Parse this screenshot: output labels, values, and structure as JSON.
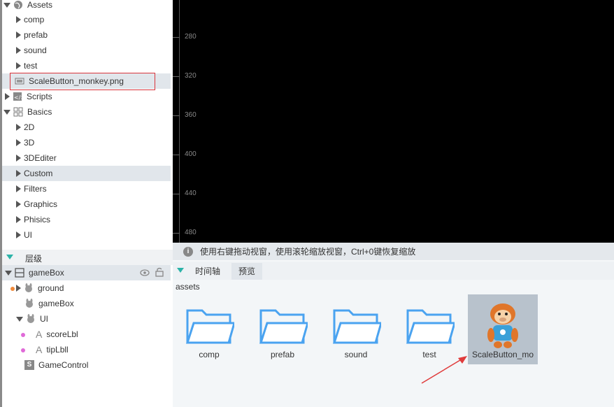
{
  "project_tree": {
    "items": [
      {
        "label": "Assets",
        "depth": 0,
        "icon": "globe-icon"
      },
      {
        "label": "comp",
        "depth": 1
      },
      {
        "label": "prefab",
        "depth": 1
      },
      {
        "label": "sound",
        "depth": 1
      },
      {
        "label": "test",
        "depth": 1
      },
      {
        "label": "ScaleButton_monkey.png",
        "depth": 1,
        "icon": "image-file-icon"
      },
      {
        "label": "Scripts",
        "depth": 0,
        "icon": "script-icon"
      },
      {
        "label": "Basics",
        "depth": 0,
        "icon": "grid-icon"
      },
      {
        "label": "2D",
        "depth": 1
      },
      {
        "label": "3D",
        "depth": 1
      },
      {
        "label": "3DEditer",
        "depth": 1
      },
      {
        "label": "Custom",
        "depth": 1
      },
      {
        "label": "Filters",
        "depth": 1
      },
      {
        "label": "Graphics",
        "depth": 1
      },
      {
        "label": "Phisics",
        "depth": 1
      },
      {
        "label": "UI",
        "depth": 1
      }
    ]
  },
  "hierarchy": {
    "title": "层级",
    "root": "gameBox",
    "nodes": [
      {
        "label": "ground"
      },
      {
        "label": "gameBox"
      },
      {
        "label": "UI"
      },
      {
        "label": "scoreLbl"
      },
      {
        "label": "tipLbll"
      },
      {
        "label": "GameControl"
      }
    ]
  },
  "ruler": {
    "labels": [
      "280",
      "320",
      "360",
      "400",
      "440",
      "480"
    ]
  },
  "tip": {
    "text": "使用右键拖动视窗，使用滚轮缩放视窗，Ctrl+0键恢复缩放"
  },
  "bottom_tabs": {
    "items": [
      "时间轴",
      "预览"
    ],
    "active": "预览"
  },
  "browser": {
    "path": "assets",
    "items": [
      "comp",
      "prefab",
      "sound",
      "test",
      "ScaleButton_mo"
    ]
  },
  "colors": {
    "folder": "#4aa3f0",
    "highlight_border": "#d9343b",
    "annotation_arrow": "#e03c3c",
    "selection": "#e1e6eb"
  }
}
